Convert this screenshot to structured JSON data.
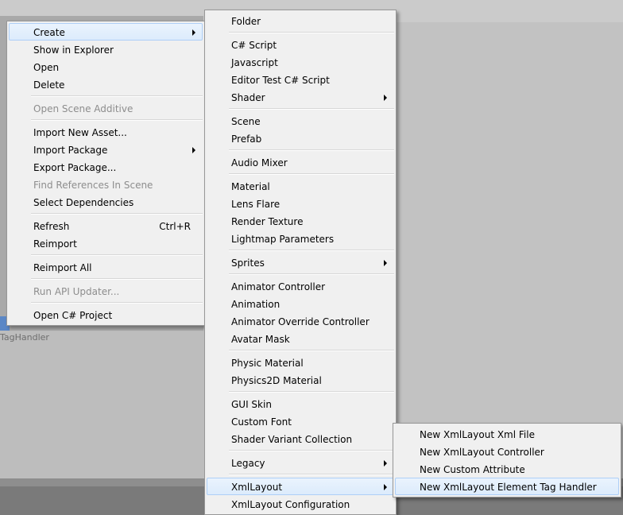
{
  "context_menu": {
    "items": [
      {
        "label": "Create",
        "submenu": true,
        "highlighted": true
      },
      {
        "label": "Show in Explorer"
      },
      {
        "label": "Open"
      },
      {
        "label": "Delete"
      },
      {
        "separator": true
      },
      {
        "label": "Open Scene Additive",
        "disabled": true
      },
      {
        "separator": true
      },
      {
        "label": "Import New Asset..."
      },
      {
        "label": "Import Package",
        "submenu": true
      },
      {
        "label": "Export Package..."
      },
      {
        "label": "Find References In Scene",
        "disabled": true
      },
      {
        "label": "Select Dependencies"
      },
      {
        "separator": true
      },
      {
        "label": "Refresh",
        "shortcut": "Ctrl+R"
      },
      {
        "label": "Reimport"
      },
      {
        "separator": true
      },
      {
        "label": "Reimport All"
      },
      {
        "separator": true
      },
      {
        "label": "Run API Updater...",
        "disabled": true
      },
      {
        "separator": true
      },
      {
        "label": "Open C# Project"
      }
    ]
  },
  "create_menu": {
    "items": [
      {
        "label": "Folder"
      },
      {
        "separator": true
      },
      {
        "label": "C# Script"
      },
      {
        "label": "Javascript"
      },
      {
        "label": "Editor Test C# Script"
      },
      {
        "label": "Shader",
        "submenu": true
      },
      {
        "separator": true
      },
      {
        "label": "Scene"
      },
      {
        "label": "Prefab"
      },
      {
        "separator": true
      },
      {
        "label": "Audio Mixer"
      },
      {
        "separator": true
      },
      {
        "label": "Material"
      },
      {
        "label": "Lens Flare"
      },
      {
        "label": "Render Texture"
      },
      {
        "label": "Lightmap Parameters"
      },
      {
        "separator": true
      },
      {
        "label": "Sprites",
        "submenu": true
      },
      {
        "separator": true
      },
      {
        "label": "Animator Controller"
      },
      {
        "label": "Animation"
      },
      {
        "label": "Animator Override Controller"
      },
      {
        "label": "Avatar Mask"
      },
      {
        "separator": true
      },
      {
        "label": "Physic Material"
      },
      {
        "label": "Physics2D Material"
      },
      {
        "separator": true
      },
      {
        "label": "GUI Skin"
      },
      {
        "label": "Custom Font"
      },
      {
        "label": "Shader Variant Collection"
      },
      {
        "separator": true
      },
      {
        "label": "Legacy",
        "submenu": true
      },
      {
        "separator": true
      },
      {
        "label": "XmlLayout",
        "submenu": true,
        "highlighted": true
      },
      {
        "label": "XmlLayout Configuration"
      }
    ]
  },
  "xmllayout_menu": {
    "items": [
      {
        "label": "New XmlLayout Xml File"
      },
      {
        "label": "New XmlLayout Controller"
      },
      {
        "label": "New Custom Attribute"
      },
      {
        "label": "New XmlLayout Element Tag Handler",
        "highlighted": true
      }
    ]
  },
  "background": {
    "selected_asset_text": "TagHandler"
  },
  "colors": {
    "menu_bg": "#f0f0f0",
    "highlight_bg": "#dcebfc",
    "highlight_border": "#aecff7",
    "disabled_text": "#8d8d8d"
  }
}
